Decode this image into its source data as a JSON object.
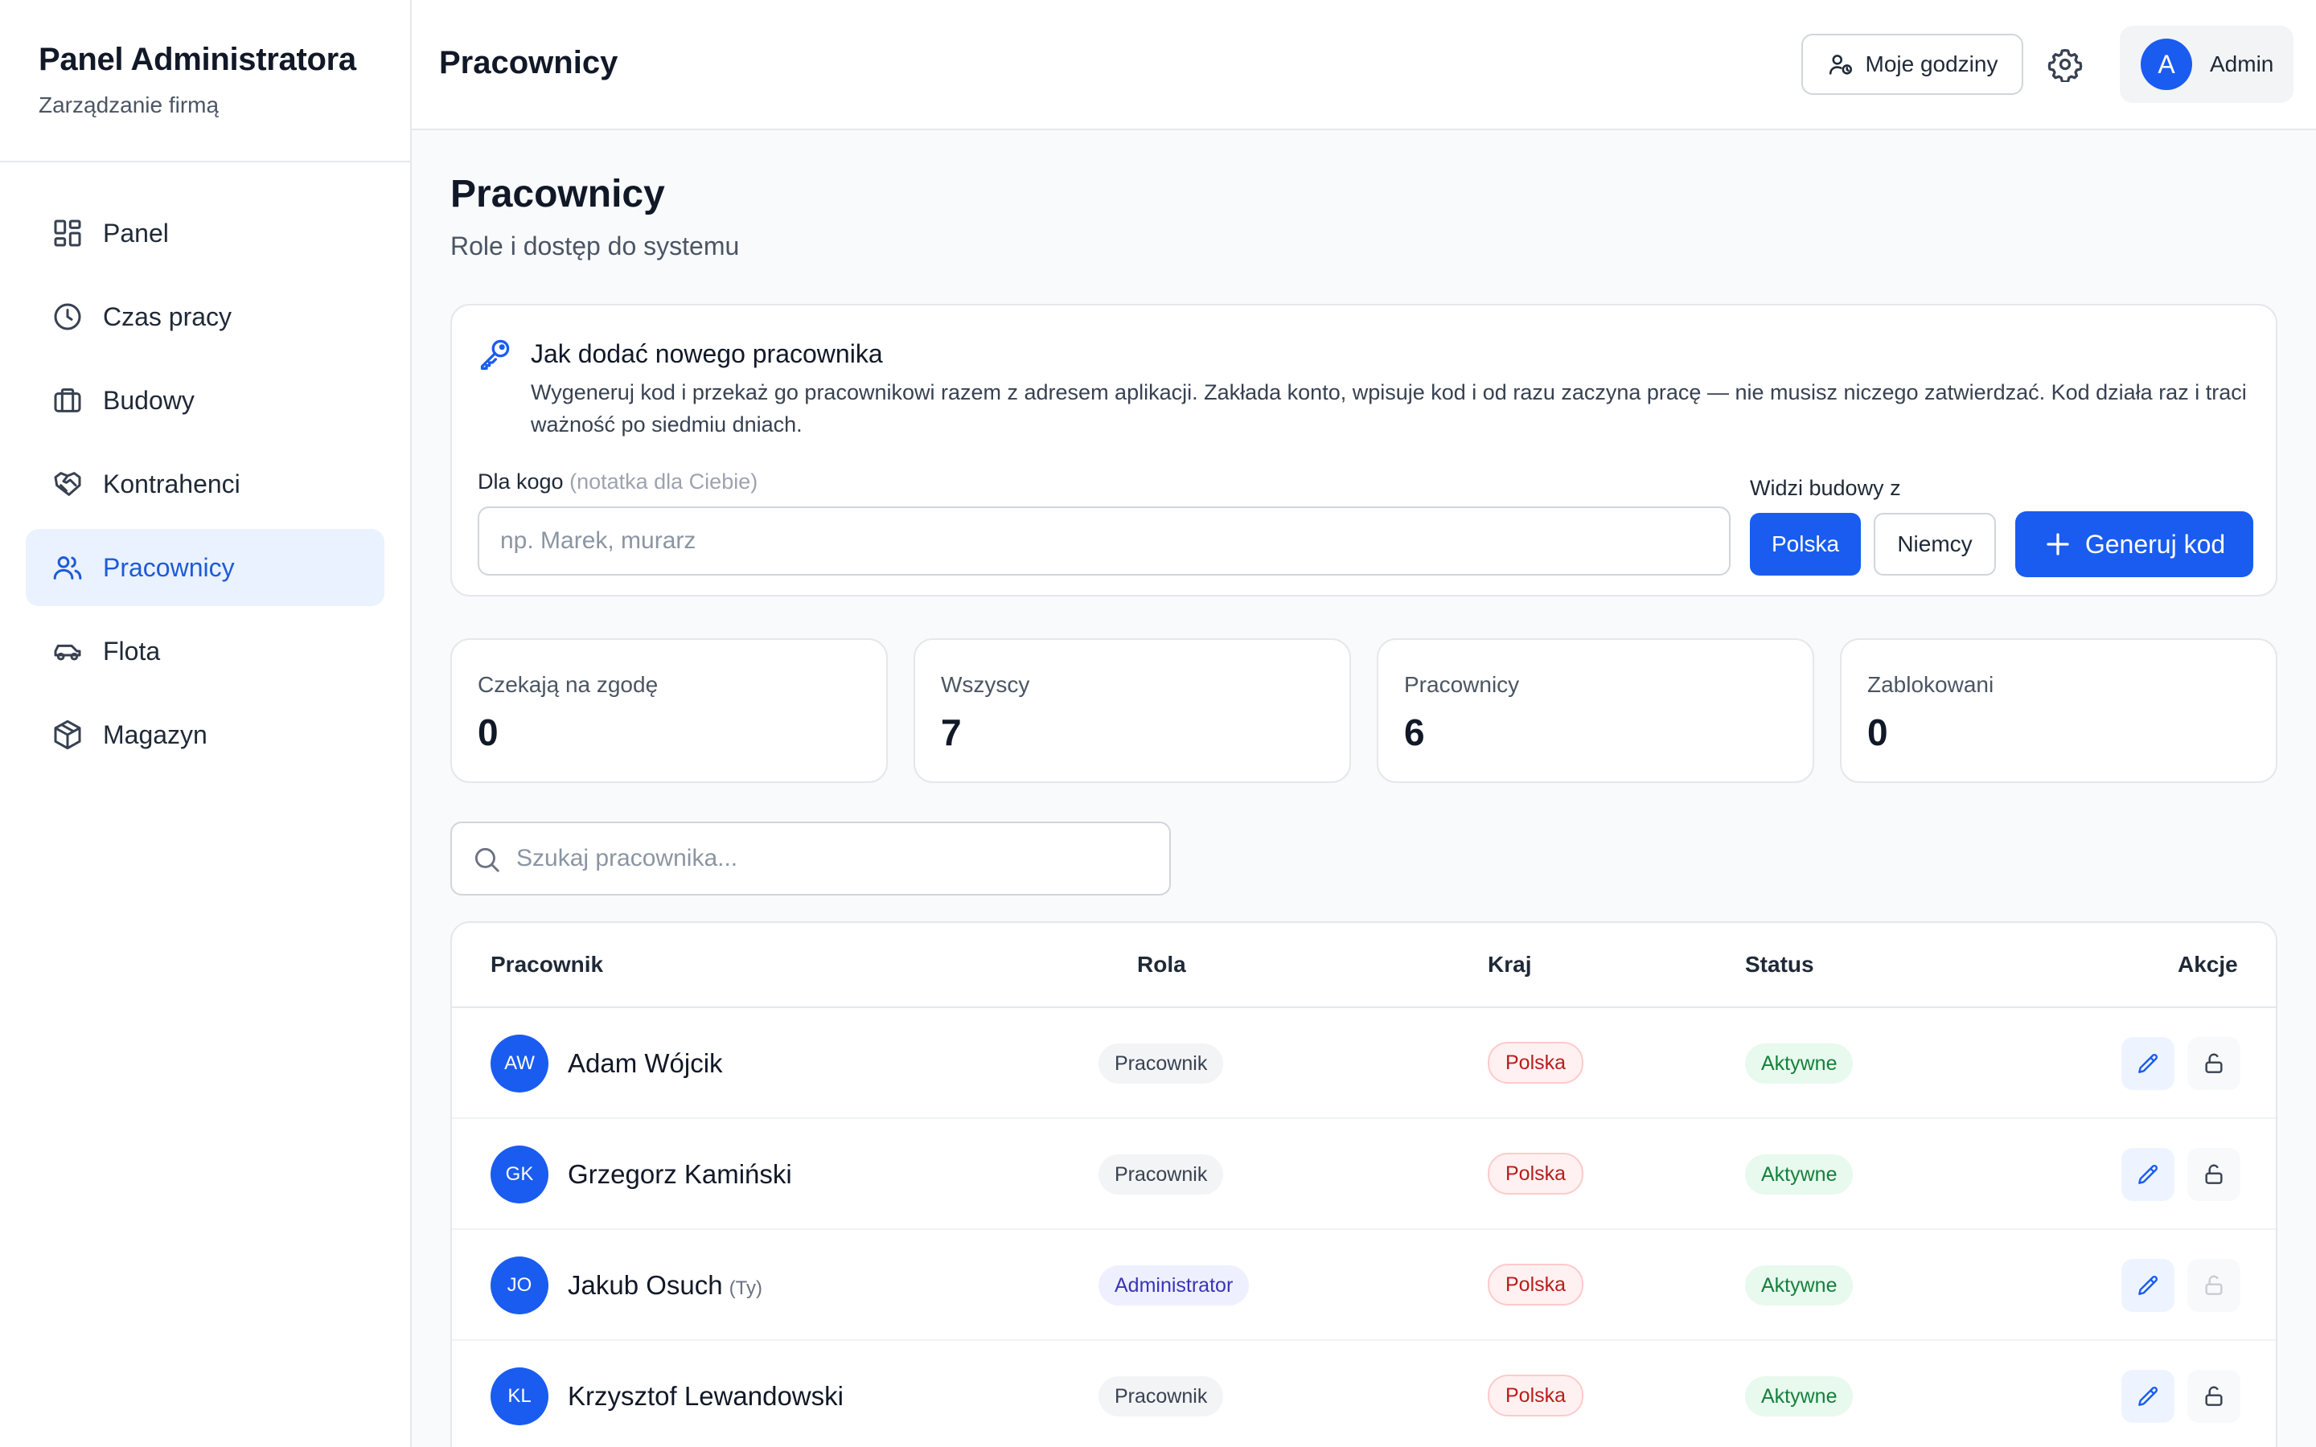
{
  "sidebar": {
    "title": "Panel Administratora",
    "subtitle": "Zarządzanie firmą",
    "items": [
      {
        "label": "Panel",
        "icon": "dashboard-icon"
      },
      {
        "label": "Czas pracy",
        "icon": "clock-icon"
      },
      {
        "label": "Budowy",
        "icon": "briefcase-icon"
      },
      {
        "label": "Kontrahenci",
        "icon": "handshake-icon"
      },
      {
        "label": "Pracownicy",
        "icon": "users-icon",
        "active": true
      },
      {
        "label": "Flota",
        "icon": "car-icon"
      },
      {
        "label": "Magazyn",
        "icon": "box-icon"
      }
    ]
  },
  "topbar": {
    "title": "Pracownicy",
    "my_hours_label": "Moje godziny",
    "user_initial": "A",
    "user_name": "Admin"
  },
  "page": {
    "title": "Pracownicy",
    "subtitle": "Role i dostęp do systemu"
  },
  "invite": {
    "title": "Jak dodać nowego pracownika",
    "description": "Wygeneruj kod i przekaż go pracownikowi razem z adresem aplikacji. Zakłada konto, wpisuje kod i od razu zaczyna pracę — nie musisz niczego zatwierdzać. Kod działa raz i traci ważność po siedmiu dniach.",
    "for_label": "Dla kogo",
    "for_hint": "(notatka dla Ciebie)",
    "for_placeholder": "np. Marek, murarz",
    "for_value": "",
    "sees_label": "Widzi budowy z",
    "country_options": [
      "Polska",
      "Niemcy"
    ],
    "country_selected": "Polska",
    "generate_label": "Generuj kod"
  },
  "stats": [
    {
      "label": "Czekają na zgodę",
      "value": "0"
    },
    {
      "label": "Wszyscy",
      "value": "7"
    },
    {
      "label": "Pracownicy",
      "value": "6"
    },
    {
      "label": "Zablokowani",
      "value": "0"
    }
  ],
  "search": {
    "placeholder": "Szukaj pracownika...",
    "value": ""
  },
  "table": {
    "columns": [
      "Pracownik",
      "Rola",
      "Kraj",
      "Status",
      "Akcje"
    ],
    "rows": [
      {
        "initials": "AW",
        "name": "Adam Wójcik",
        "me": "",
        "role": "Pracownik",
        "country": "Polska",
        "status": "Aktywne"
      },
      {
        "initials": "GK",
        "name": "Grzegorz Kamiński",
        "me": "",
        "role": "Pracownik",
        "country": "Polska",
        "status": "Aktywne"
      },
      {
        "initials": "JO",
        "name": "Jakub Osuch",
        "me": "(Ty)",
        "role": "Administrator",
        "country": "Polska",
        "status": "Aktywne"
      },
      {
        "initials": "KL",
        "name": "Krzysztof Lewandowski",
        "me": "",
        "role": "Pracownik",
        "country": "Polska",
        "status": "Aktywne"
      }
    ]
  },
  "colors": {
    "accent": "#1a5cf0",
    "active_nav_bg": "#eaf2ff",
    "status_active_bg": "#e8f9ee",
    "status_active_text": "#15803d",
    "country_bg": "#fff1f1",
    "country_text": "#b91c1c",
    "admin_role_bg": "#eef0ff"
  }
}
